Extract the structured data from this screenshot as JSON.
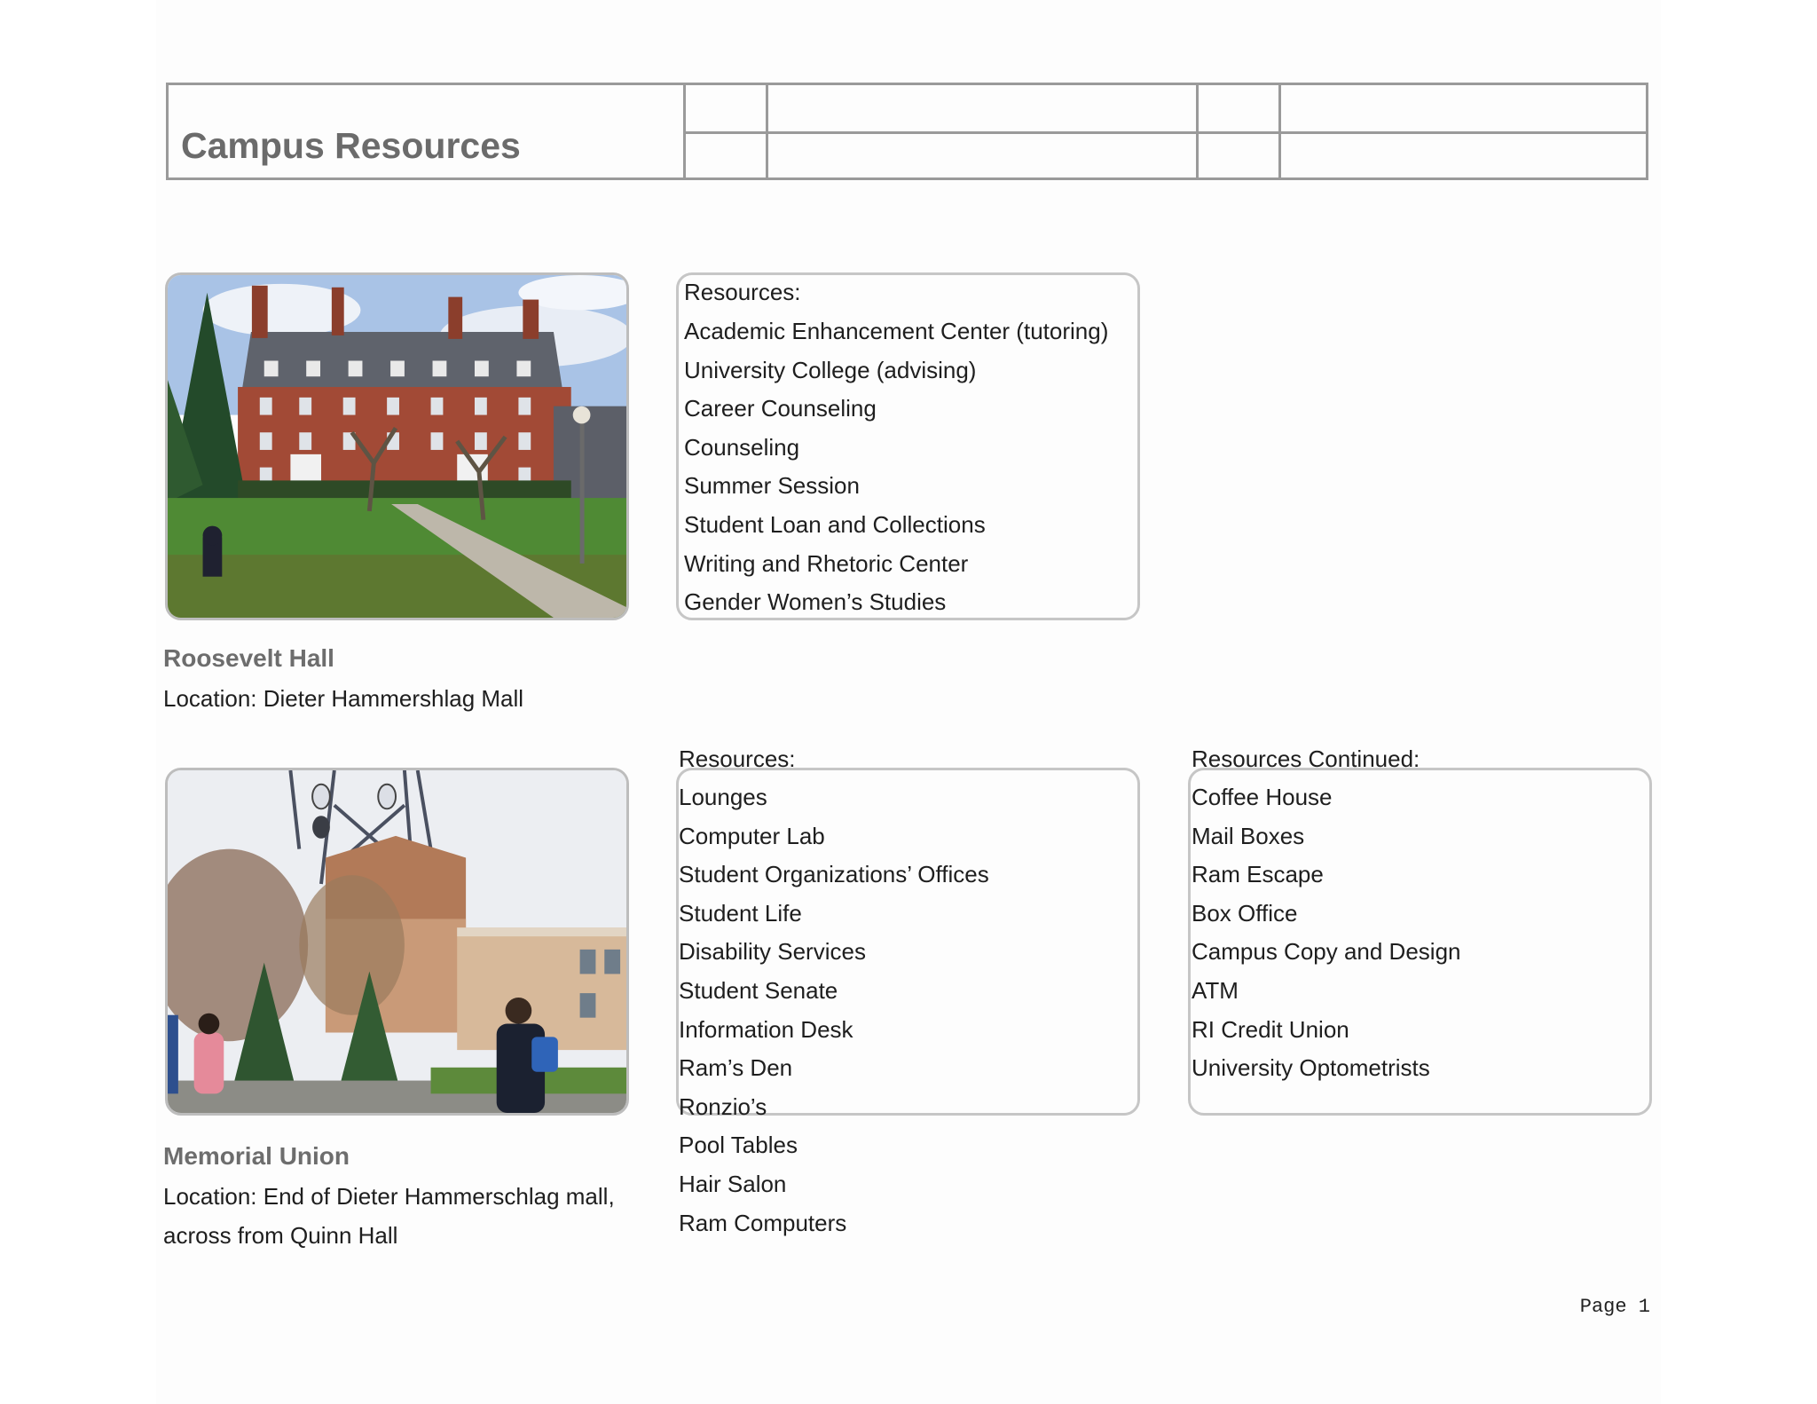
{
  "header": {
    "title": "Campus Resources"
  },
  "section1": {
    "building_name": "Roosevelt Hall",
    "location": "Location: Dieter Hammershlag Mall",
    "resources_heading": "Resources:",
    "resources": [
      "Academic Enhancement Center (tutoring)",
      "University College (advising)",
      "Career Counseling",
      "Counseling",
      "Summer Session",
      "Student Loan and Collections",
      "Writing and Rhetoric Center",
      "Gender Women’s Studies"
    ]
  },
  "section2": {
    "building_name": "Memorial Union",
    "location_line1": "Location: End of Dieter Hammerschlag mall,",
    "location_line2": "across from Quinn Hall",
    "resources_heading": "Resources:",
    "resources": [
      "Lounges",
      "Computer Lab",
      "Student Organizations’ Offices",
      "Student Life",
      "Disability Services",
      "Student Senate",
      "Information Desk",
      "Ram’s Den",
      "Ronzio’s",
      "Pool Tables",
      "Hair Salon",
      "Ram Computers"
    ],
    "resources_continued_heading": "Resources Continued:",
    "resources_continued": [
      "Coffee House",
      "Mail Boxes",
      "Ram Escape",
      "Box Office",
      "Campus Copy and Design",
      "ATM",
      "RI Credit Union",
      "University Optometrists"
    ]
  },
  "footer": {
    "page_label": "Page 1"
  }
}
